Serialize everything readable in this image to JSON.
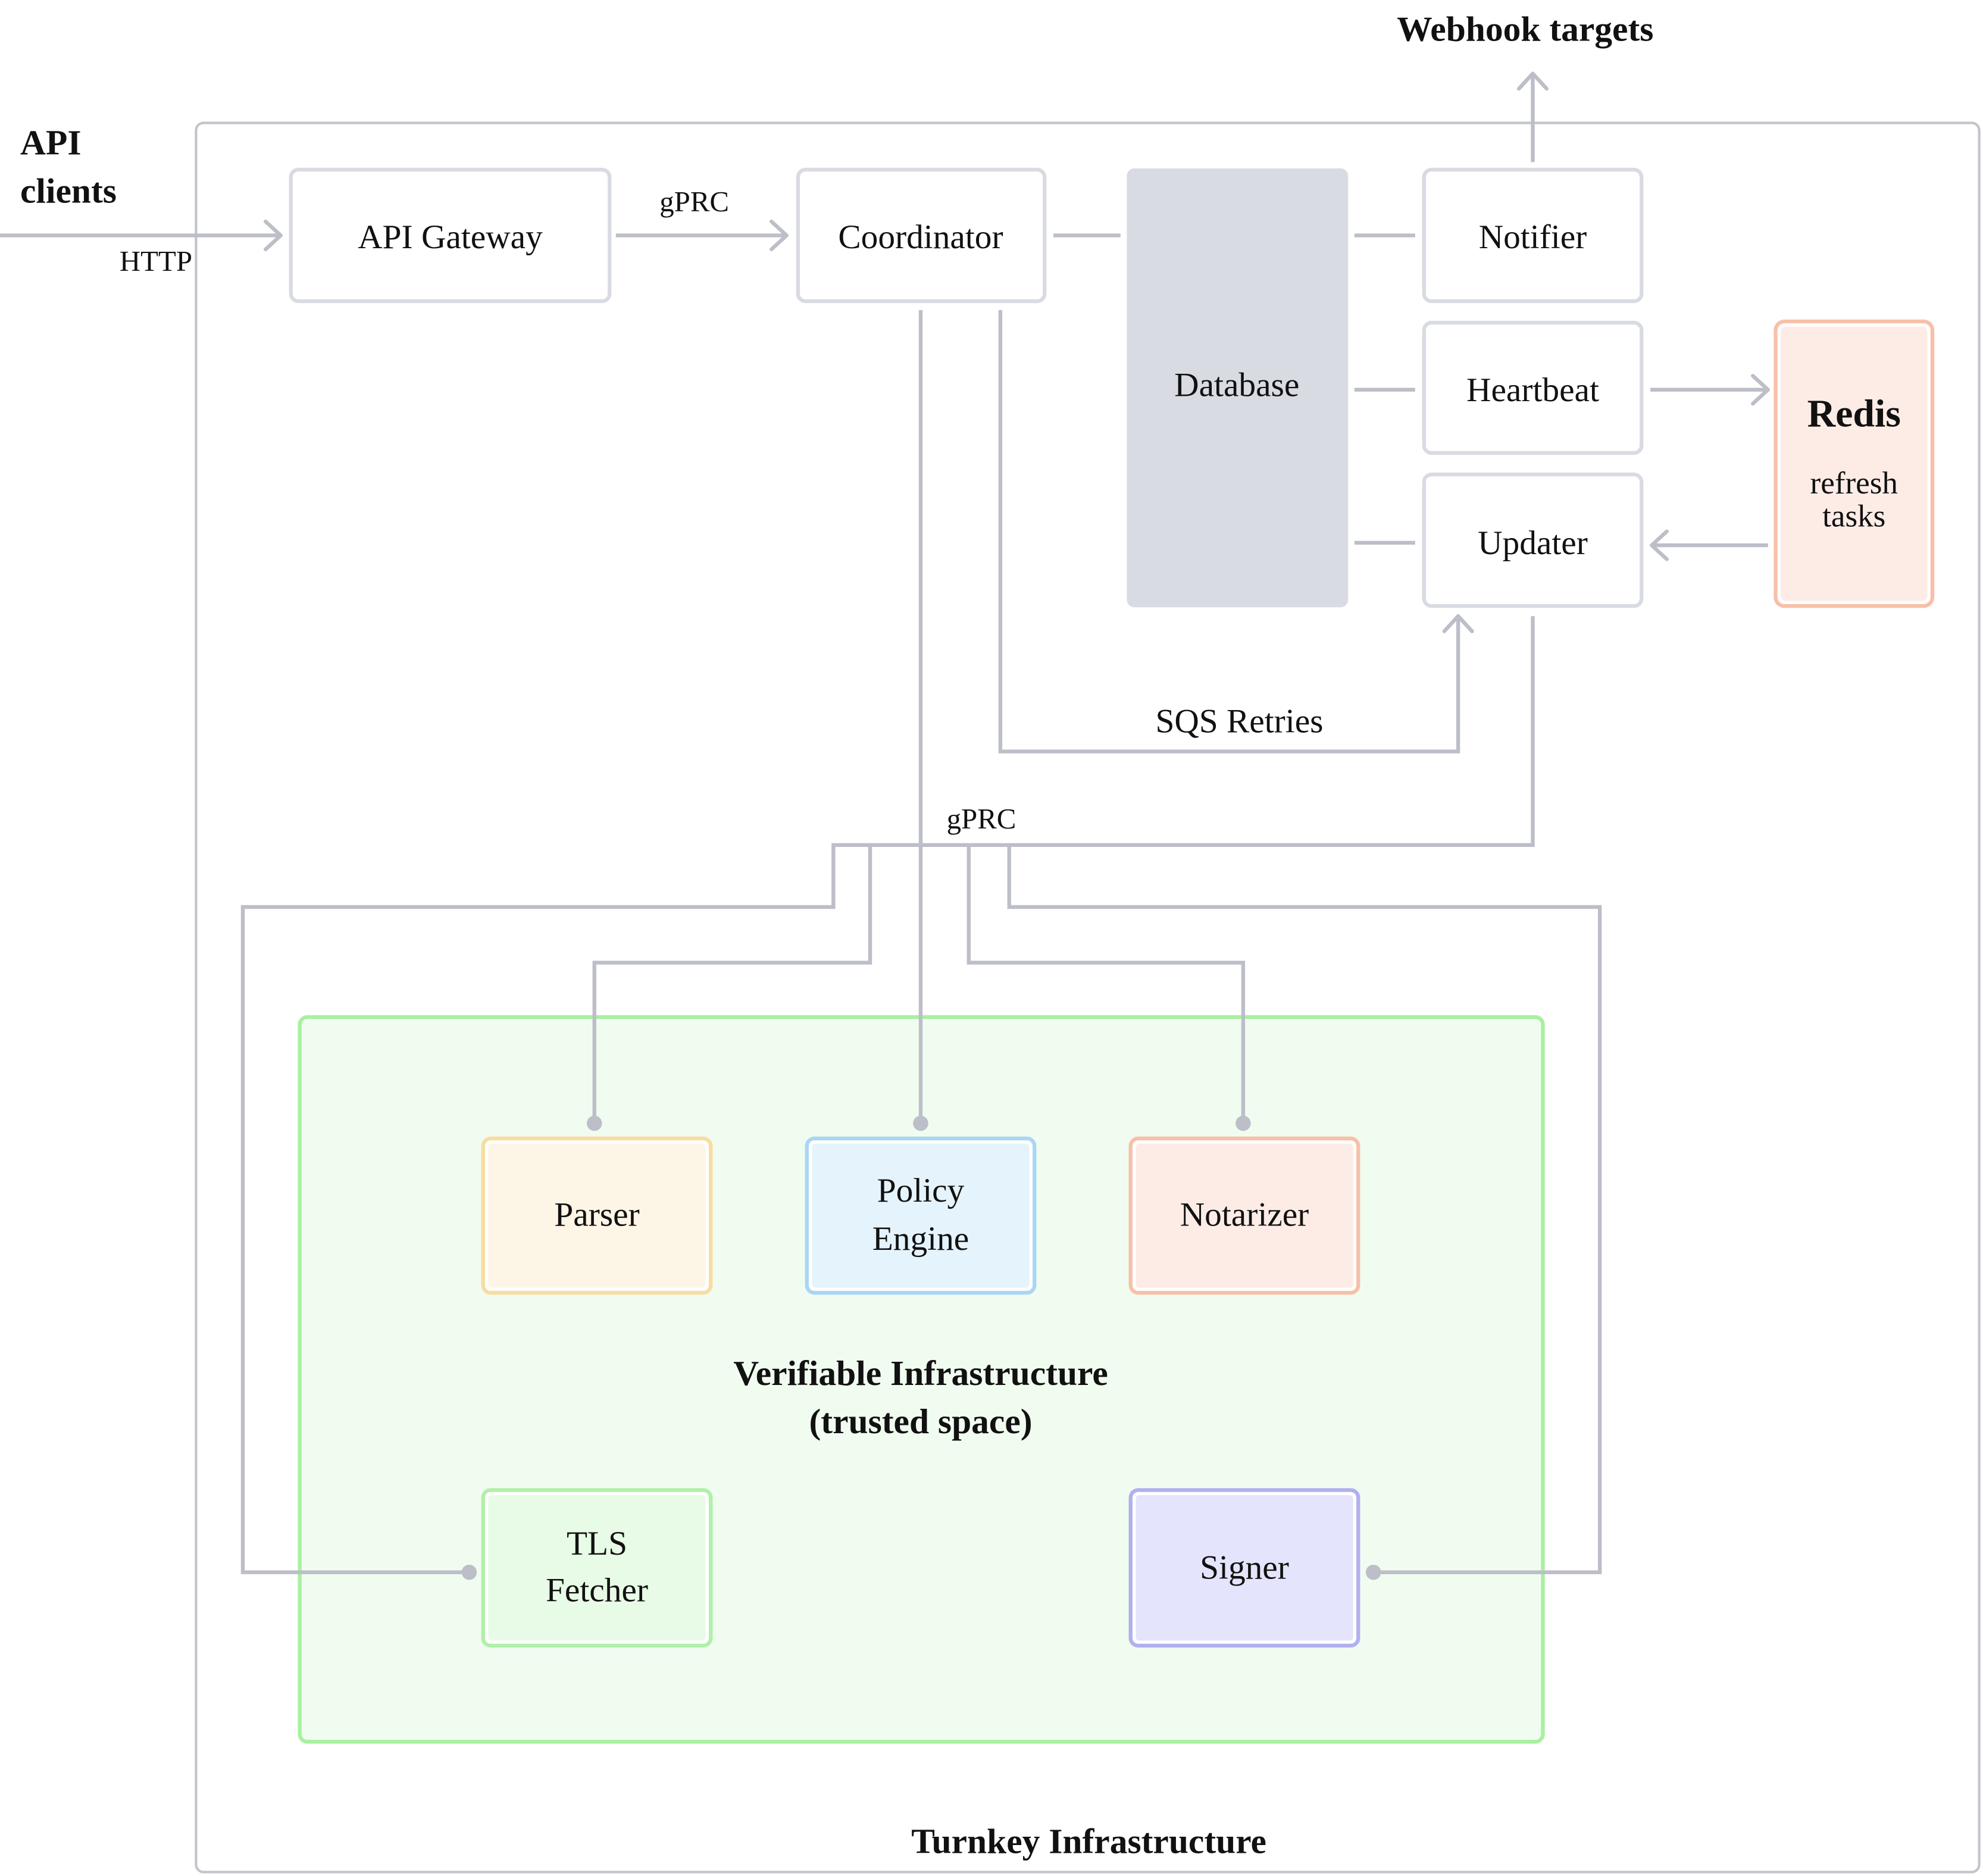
{
  "title_top": "Webhook targets",
  "api_clients": [
    "API",
    "clients"
  ],
  "labels": {
    "http": "HTTP",
    "grpc_top": "gPRC",
    "grpc_mid": "gPRC",
    "sqs": "SQS Retries"
  },
  "nodes": {
    "api_gateway": "API Gateway",
    "coordinator": "Coordinator",
    "database": "Database",
    "notifier": "Notifier",
    "heartbeat": "Heartbeat",
    "updater": "Updater",
    "redis": {
      "title": "Redis",
      "sub1": "refresh",
      "sub2": "tasks"
    },
    "parser": "Parser",
    "policy_engine": [
      "Policy",
      "Engine"
    ],
    "notarizer": "Notarizer",
    "tls_fetcher": [
      "TLS",
      "Fetcher"
    ],
    "signer": "Signer"
  },
  "groups": {
    "verifiable": [
      "Verifiable Infrastructure",
      "(trusted space)"
    ],
    "turnkey": "Turnkey Infrastructure"
  },
  "colors": {
    "line": "#bcbec8",
    "database": "#d9dbe3",
    "green": "#a8f0a0",
    "redis": "#f8c0a8"
  }
}
